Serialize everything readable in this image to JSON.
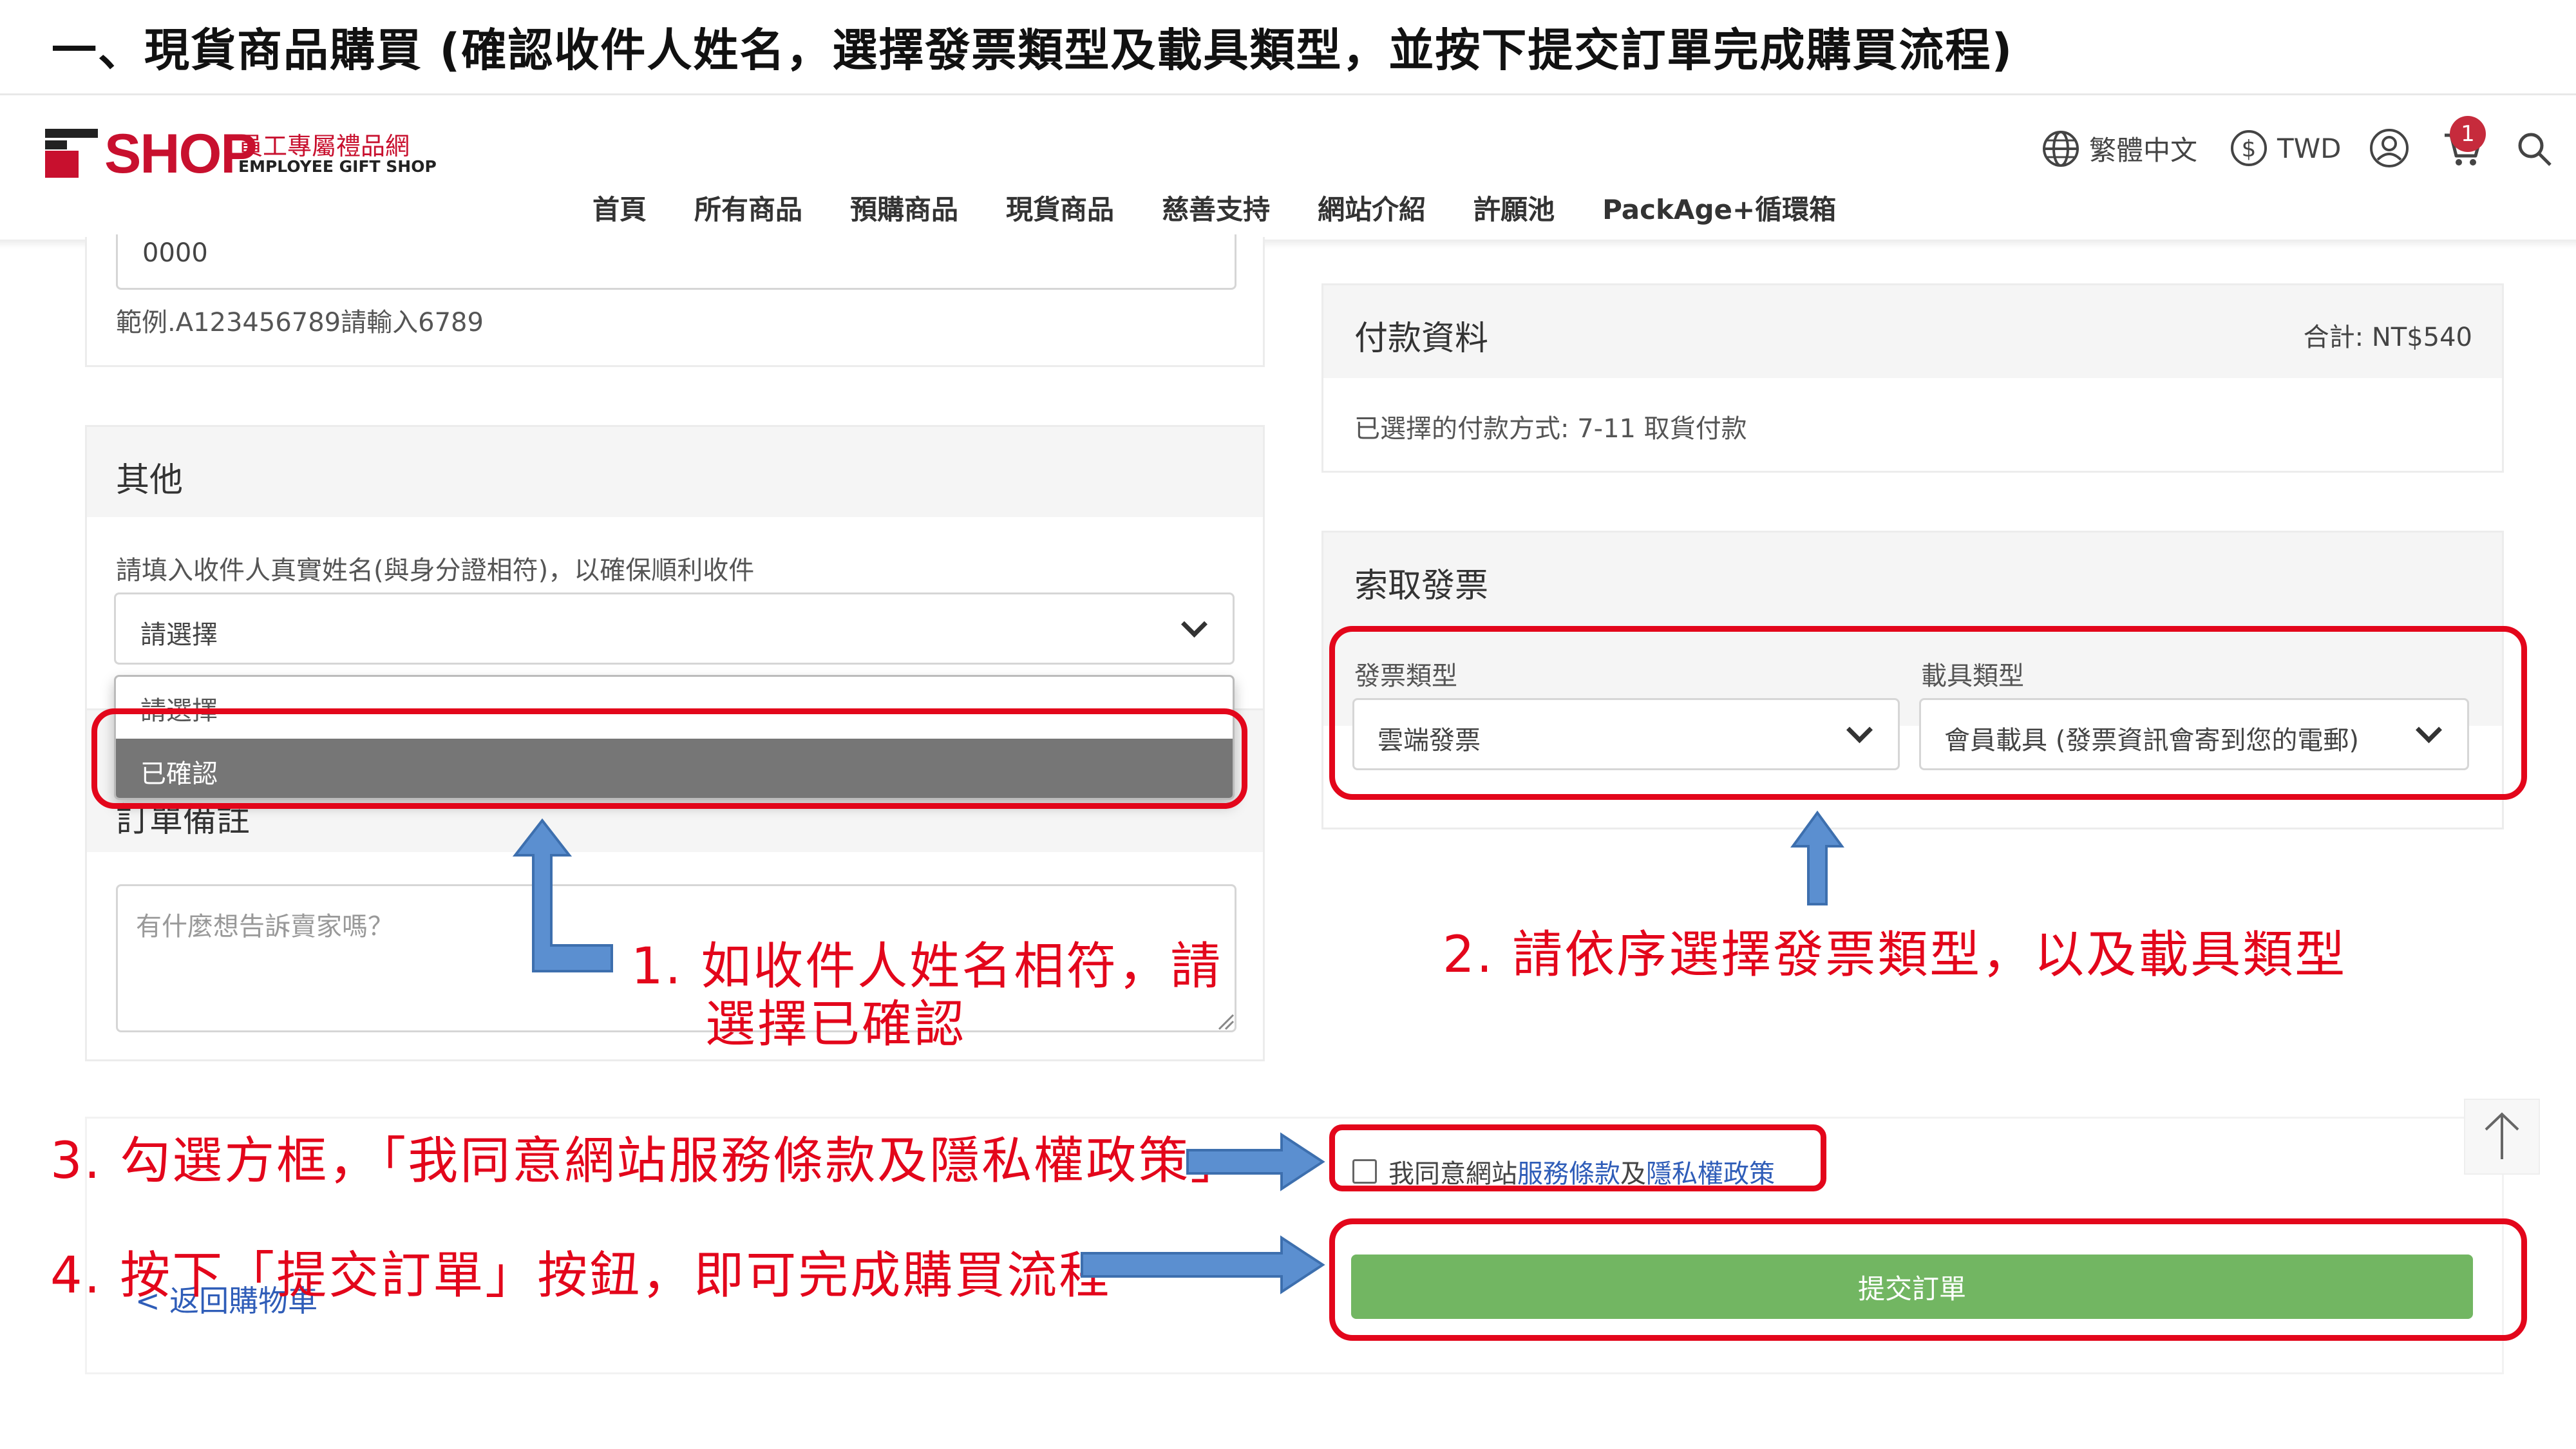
{
  "tutorial": {
    "title": "一、現貨商品購買 (確認收件人姓名，選擇發票類型及載具類型，並按下提交訂單完成購買流程)",
    "step1_line1": "1.  如收件人姓名相符，請",
    "step1_line2": "選擇已確認",
    "step2": "2.  請依序選擇發票類型，以及載具類型",
    "step3": "3.  勾選方框，「我同意網站服務條款及隱私權政策」",
    "step4": "4.  按下「提交訂單」按鈕，即可完成購買流程"
  },
  "logo": {
    "word": "SHOP",
    "zh": "員工專屬禮品網",
    "en": "EMPLOYEE GIFT SHOP"
  },
  "header": {
    "language": "繁體中文",
    "currency": "TWD",
    "cart_count": "1"
  },
  "nav": {
    "items": [
      "首頁",
      "所有商品",
      "預購商品",
      "現貨商品",
      "慈善支持",
      "網站介紹",
      "許願池",
      "PackAge+循環箱"
    ]
  },
  "id_section": {
    "value": "0000",
    "hint": "範例.A123456789請輸入6789"
  },
  "other": {
    "title": "其他",
    "name_label": "請填入收件人真實姓名(與身分證相符)，以確保順利收件",
    "select_value": "請選擇",
    "options": [
      "請選擇",
      "已確認"
    ],
    "remarks_title": "訂單備註",
    "remarks_placeholder": "有什麼想告訴賣家嗎？"
  },
  "payment": {
    "title": "付款資料",
    "total": "合計: NT$540",
    "method": "已選擇的付款方式: 7-11 取貨付款"
  },
  "invoice": {
    "title": "索取發票",
    "type_label": "發票類型",
    "type_value": "雲端發票",
    "carrier_label": "載具類型",
    "carrier_value": "會員載具 (發票資訊會寄到您的電郵)"
  },
  "agree": {
    "prefix": "我同意網站",
    "terms": "服務條款",
    "and": "及",
    "privacy": "隱私權政策"
  },
  "submit_label": "提交訂單",
  "back_link": "< 返回購物車",
  "colors": {
    "brand": "#c8102e",
    "annotation_red": "#e3061b",
    "annotation_blue": "#5b8fd0",
    "submit_green": "#72b662",
    "link_blue": "#2f5db8"
  }
}
